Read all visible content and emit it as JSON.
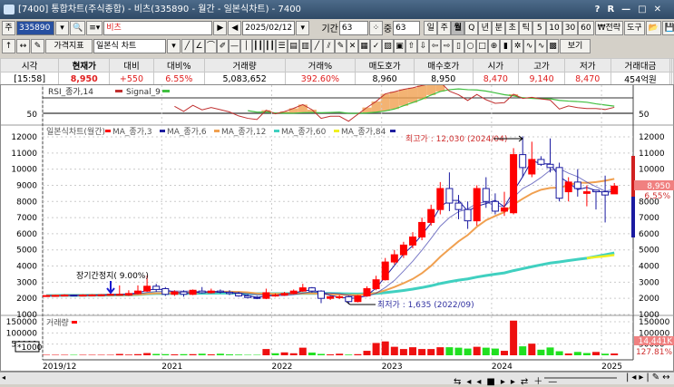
{
  "window": {
    "title": "[7400]  통합차트(주식종합) - 비츠(335890 - 월간 - 일본식차트) - 7400",
    "controls": [
      "?",
      "R",
      "—",
      "□",
      "✕"
    ]
  },
  "toolbar1": {
    "code_label": "주",
    "code": "335890",
    "name": "비츠",
    "date": "2025/02/12",
    "period_label": "기간",
    "period": "63",
    "count_label": "중",
    "count": "63",
    "intervals": [
      "일",
      "주",
      "월",
      "Q",
      "년",
      "분",
      "초",
      "틱",
      "5",
      "10",
      "30",
      "60"
    ],
    "active_interval": "월",
    "strategy": "₩전략",
    "tools": "도구"
  },
  "toolbar2": {
    "indicator": "가격지표",
    "chart_type": "일본식 차트",
    "view": "보기"
  },
  "quote": {
    "headers": [
      "시각",
      "현재가",
      "대비",
      "대비%",
      "거래량",
      "거래%",
      "매도호가",
      "매수호가",
      "시가",
      "고가",
      "저가",
      "거래대금"
    ],
    "values": [
      "[15:58]",
      "8,950",
      "+550",
      "6.55%",
      "5,083,652",
      "392.60%",
      "8,960",
      "8,950",
      "8,470",
      "9,140",
      "8,470",
      "454억원"
    ]
  },
  "colors": {
    "up": "#ff0000",
    "down": "#1a1aa0",
    "ma3": "#2020a0",
    "ma6": "#2020a0",
    "ma12": "#f0a050",
    "ma60": "#40d0c0",
    "ma84": "#f0f020",
    "rsi": "#c03030",
    "signal": "#40c040"
  },
  "chart_data": {
    "type": "candlestick",
    "rsi_legend": {
      "rsi": "RSI_종가,14",
      "signal": "Signal_9"
    },
    "rsi_ticks": [
      "50",
      "50"
    ],
    "price_legend": {
      "title": "일본식차트(월간)",
      "items": [
        "MA_종가,3",
        "MA_종가,6",
        "MA_종가,12",
        "MA_종가,60",
        "MA_종가,84"
      ]
    },
    "volume_legend": "거래량",
    "volume_unit": "*1000",
    "yticks": [
      12000,
      11000,
      10000,
      9000,
      8000,
      7000,
      6000,
      5000,
      4000,
      3000,
      2000,
      1000
    ],
    "vticks": [
      150000,
      100000,
      50000
    ],
    "ylim": [
      1000,
      12000
    ],
    "vlim": [
      0,
      150000
    ],
    "xlabels": [
      {
        "i": 0,
        "t": "2019/12"
      },
      {
        "i": 13,
        "t": "2021"
      },
      {
        "i": 25,
        "t": "2022"
      },
      {
        "i": 37,
        "t": "2023"
      },
      {
        "i": 49,
        "t": "2024"
      },
      {
        "i": 61,
        "t": "2025"
      }
    ],
    "annotations": {
      "high": "최고가 : 12,030 (2024/04)",
      "low": "최저가 : 1,635 (2022/09)",
      "halt": "장기간정지( 9.00%)"
    },
    "current": {
      "price": "8,950",
      "pct": "6.55%",
      "volume": "14,441K",
      "vol_pct": "127.81%"
    },
    "ohlc": [
      [
        2150,
        2200,
        2100,
        2170
      ],
      [
        2170,
        2220,
        2120,
        2180
      ],
      [
        2180,
        2250,
        2150,
        2200
      ],
      [
        2200,
        2230,
        2150,
        2180
      ],
      [
        2180,
        2250,
        2150,
        2200
      ],
      [
        2200,
        2250,
        2160,
        2210
      ],
      [
        2210,
        2260,
        2180,
        2220
      ],
      [
        2220,
        2300,
        2200,
        2250
      ],
      [
        2250,
        2800,
        2200,
        2250
      ],
      [
        2200,
        2500,
        2150,
        2300
      ],
      [
        2300,
        2800,
        2250,
        2450
      ],
      [
        2450,
        3400,
        2400,
        2750
      ],
      [
        2750,
        2900,
        2400,
        2550
      ],
      [
        2600,
        2700,
        2150,
        2250
      ],
      [
        2250,
        2500,
        2150,
        2400
      ],
      [
        2400,
        2500,
        2100,
        2250
      ],
      [
        2250,
        2550,
        2200,
        2500
      ],
      [
        2450,
        2700,
        2300,
        2350
      ],
      [
        2350,
        2600,
        2300,
        2450
      ],
      [
        2450,
        2550,
        2300,
        2380
      ],
      [
        2380,
        2500,
        2200,
        2300
      ],
      [
        2300,
        2400,
        2100,
        2150
      ],
      [
        2150,
        2250,
        2000,
        2050
      ],
      [
        2050,
        2150,
        1950,
        2000
      ],
      [
        2000,
        2600,
        1950,
        2350
      ],
      [
        2200,
        2300,
        2100,
        2200
      ],
      [
        2200,
        2400,
        2150,
        2300
      ],
      [
        2300,
        2550,
        2250,
        2450
      ],
      [
        2450,
        2900,
        2400,
        2650
      ],
      [
        2650,
        2700,
        2350,
        2450
      ],
      [
        2450,
        2500,
        1700,
        2000
      ],
      [
        2000,
        2150,
        1900,
        2100
      ],
      [
        2100,
        2200,
        1950,
        2100
      ],
      [
        2100,
        2150,
        1635,
        1800
      ],
      [
        1800,
        2200,
        1750,
        2150
      ],
      [
        2150,
        2750,
        2100,
        2600
      ],
      [
        2600,
        3400,
        2500,
        3150
      ],
      [
        3150,
        4500,
        3100,
        4250
      ],
      [
        4250,
        5000,
        4100,
        4700
      ],
      [
        4700,
        5500,
        4500,
        5300
      ],
      [
        5300,
        6100,
        5100,
        5800
      ],
      [
        5800,
        7000,
        5600,
        6700
      ],
      [
        6700,
        7800,
        6500,
        7500
      ],
      [
        7500,
        9200,
        7200,
        8800
      ],
      [
        8800,
        9800,
        7400,
        7900
      ],
      [
        7900,
        8400,
        6900,
        7500
      ],
      [
        7500,
        8000,
        6300,
        6800
      ],
      [
        6800,
        9000,
        6500,
        8800
      ],
      [
        8800,
        9500,
        7600,
        8000
      ],
      [
        8000,
        8500,
        7200,
        7400
      ],
      [
        7400,
        8600,
        7100,
        7600
      ],
      [
        7300,
        11300,
        7200,
        10900
      ],
      [
        10900,
        12030,
        9500,
        10100
      ],
      [
        9700,
        11700,
        9500,
        10600
      ],
      [
        10600,
        10800,
        10200,
        10300
      ],
      [
        10300,
        11900,
        9800,
        10100
      ],
      [
        10100,
        10400,
        8000,
        8200
      ],
      [
        8600,
        9500,
        8000,
        9200
      ],
      [
        9200,
        10000,
        8300,
        8800
      ],
      [
        8500,
        9000,
        7700,
        8600
      ],
      [
        8700,
        8700,
        7500,
        8600
      ],
      [
        8600,
        9600,
        6700,
        8400
      ],
      [
        8470,
        9140,
        8470,
        8950
      ]
    ],
    "volume": [
      2000,
      2000,
      2000,
      2000,
      2000,
      2000,
      2000,
      2000,
      6000,
      3000,
      5000,
      10000,
      6000,
      5000,
      4000,
      5000,
      5000,
      7000,
      4000,
      7000,
      4000,
      3000,
      2000,
      2000,
      28000,
      9000,
      13000,
      9000,
      34000,
      12000,
      6000,
      4000,
      7000,
      3000,
      5000,
      20000,
      55000,
      62000,
      38000,
      28000,
      36000,
      28000,
      28000,
      36000,
      36000,
      34000,
      30000,
      38000,
      34000,
      30000,
      20000,
      155000,
      40000,
      52000,
      25000,
      35000,
      18000,
      8000,
      15000,
      10000,
      15000,
      7000,
      8000
    ]
  }
}
